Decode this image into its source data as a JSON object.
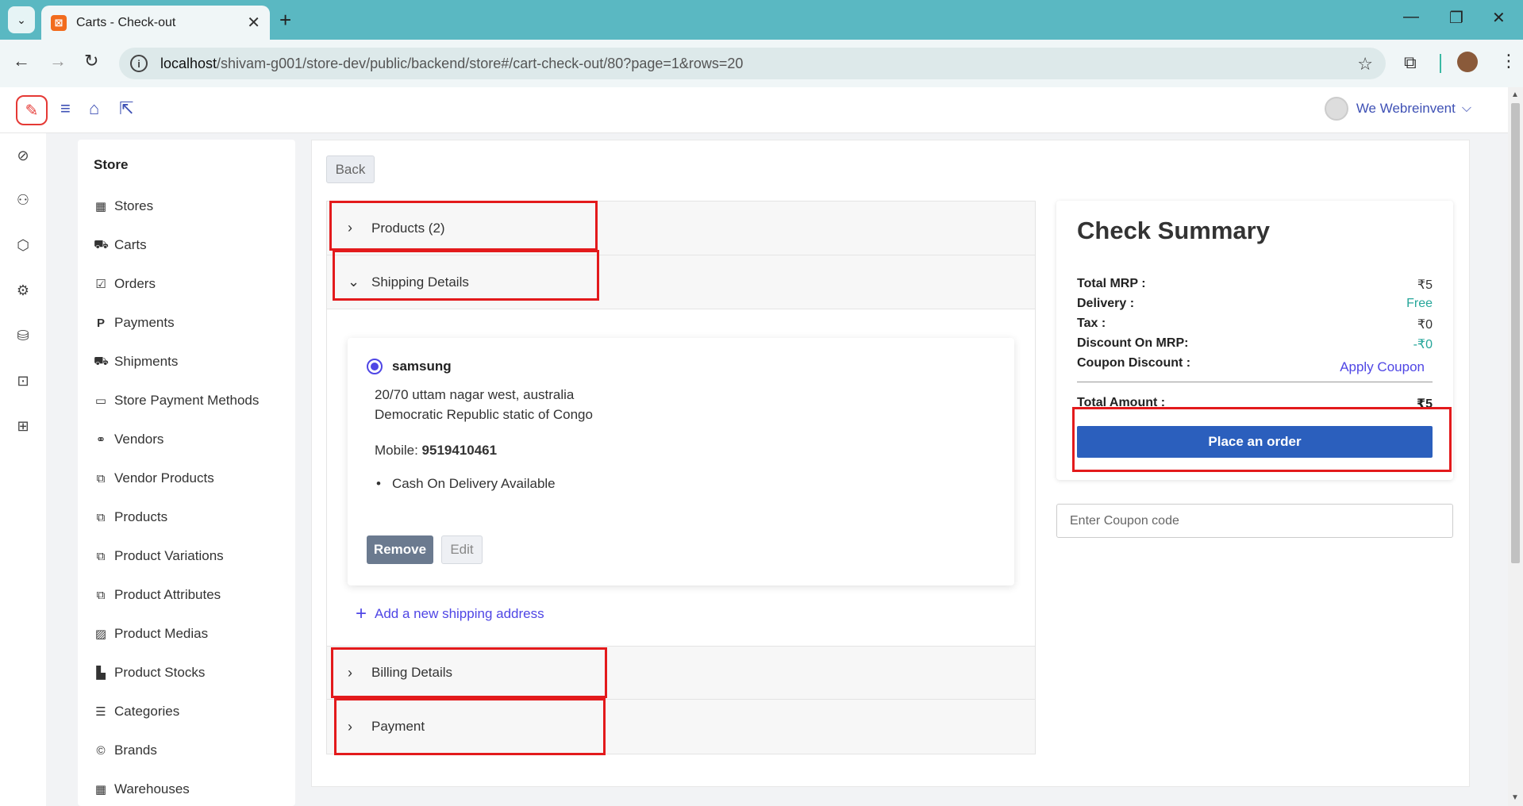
{
  "browser": {
    "tab_title": "Carts - Check-out",
    "url_host": "localhost",
    "url_path": "/shivam-g001/store-dev/public/backend/store#/cart-check-out/80?page=1&rows=20"
  },
  "header": {
    "user_name": "We Webreinvent"
  },
  "sidebar": {
    "title": "Store",
    "items": [
      {
        "label": "Stores",
        "icon": "building-icon"
      },
      {
        "label": "Carts",
        "icon": "cart-icon"
      },
      {
        "label": "Orders",
        "icon": "check-square-icon"
      },
      {
        "label": "Payments",
        "icon": "paypal-icon"
      },
      {
        "label": "Shipments",
        "icon": "truck-icon"
      },
      {
        "label": "Store Payment Methods",
        "icon": "credit-card-icon"
      },
      {
        "label": "Vendors",
        "icon": "handshake-icon"
      },
      {
        "label": "Vendor Products",
        "icon": "copy-icon"
      },
      {
        "label": "Products",
        "icon": "copy-icon"
      },
      {
        "label": "Product Variations",
        "icon": "copy-icon"
      },
      {
        "label": "Product Attributes",
        "icon": "copy-icon"
      },
      {
        "label": "Product Medias",
        "icon": "image-icon"
      },
      {
        "label": "Product Stocks",
        "icon": "chart-icon"
      },
      {
        "label": "Categories",
        "icon": "list-icon"
      },
      {
        "label": "Brands",
        "icon": "copyright-icon"
      },
      {
        "label": "Warehouses",
        "icon": "building-icon"
      }
    ]
  },
  "main": {
    "back_label": "Back",
    "accordion": {
      "products": "Products (2)",
      "shipping": "Shipping Details",
      "billing": "Billing Details",
      "payment": "Payment"
    },
    "address": {
      "name": "samsung",
      "line1": "20/70 uttam nagar west, australia",
      "line2": "Democratic Republic static of Congo",
      "mobile_label": "Mobile:",
      "mobile": "9519410461",
      "feature": "Cash On Delivery Available",
      "remove_label": "Remove",
      "edit_label": "Edit"
    },
    "add_address_label": "Add a new shipping address"
  },
  "summary": {
    "title": "Check Summary",
    "total_mrp_label": "Total MRP :",
    "total_mrp": "₹5",
    "delivery_label": "Delivery :",
    "delivery": "Free",
    "tax_label": "Tax :",
    "tax": "₹0",
    "discount_label": "Discount On MRP:",
    "discount": "-₹0",
    "coupon_label": "Coupon Discount :",
    "apply_coupon": "Apply Coupon",
    "total_amount_label": "Total Amount :",
    "total_amount": "₹5",
    "place_order": "Place an order",
    "coupon_placeholder": "Enter Coupon code"
  },
  "colors": {
    "accent": "#4f46e5",
    "primary_button": "#2b5fbd",
    "highlight": "#e31a1c",
    "teal": "#26a69a"
  }
}
